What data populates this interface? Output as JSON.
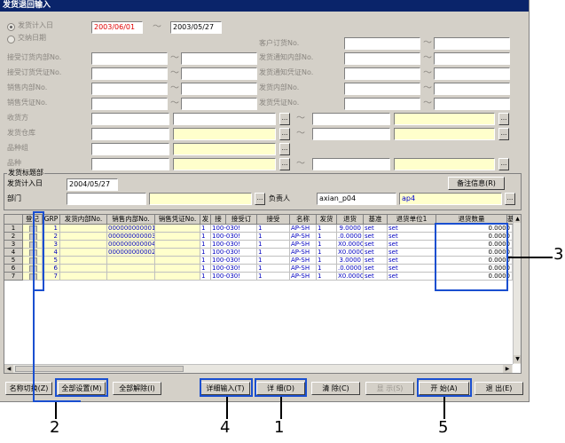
{
  "window": {
    "title": "发货退回输入"
  },
  "criteria": {
    "radio_ship_date": "发货计入日",
    "radio_contract_date": "交纳日期",
    "date_from": "2003/06/01",
    "date_to": "2003/05/27",
    "left_labels": [
      "接受订货内部No.",
      "接受订货凭证No.",
      "销售内部No.",
      "销售凭证No."
    ],
    "right_labels": [
      "客户订货No.",
      "发货通知内部No.",
      "发货通知凭证No.",
      "发货内部No.",
      "发货凭证No."
    ],
    "lower_labels": [
      "收货方",
      "发货仓库",
      "品种组",
      "品种"
    ],
    "tilde": "～",
    "search_btn": "..."
  },
  "shipment": {
    "group_title": "发货标题部",
    "date_label": "发货计入日",
    "date_value": "2004/05/27",
    "dept_label": "部门",
    "person_label": "负责人",
    "person_code": "axian_p04",
    "person_name": "ap4",
    "note_btn": "备注信息(R)"
  },
  "grid": {
    "columns": [
      "登记",
      "GRP",
      "发货内部No.",
      "销售内部No.",
      "销售凭证No.",
      "发",
      "接",
      "接受订",
      "接受",
      "名称",
      "发货",
      "退货",
      "基准",
      "退货单位1",
      "退货数量",
      "基"
    ],
    "rows": [
      {
        "no": "1",
        "grp": "1",
        "sales_no": "000000000001",
        "a": "1",
        "b": "100-030!",
        "c": "1",
        "name": "AP-SH",
        "d": "1",
        "qty": "9.0000",
        "unit": "set",
        "unit1": "set",
        "ret_qty": "0.0000"
      },
      {
        "no": "2",
        "grp": "2",
        "sales_no": "000000000003",
        "a": "1",
        "b": "100-030!",
        "c": "1",
        "name": "AP-SH",
        "d": "1",
        "qty": ".0.0000",
        "unit": "set",
        "unit1": "set",
        "ret_qty": "0.0000"
      },
      {
        "no": "3",
        "grp": "3",
        "sales_no": "000000000004",
        "a": "1",
        "b": "100-030!",
        "c": "1",
        "name": "AP-SH",
        "d": "1",
        "qty": "X0.0000",
        "unit": "set",
        "unit1": "set",
        "ret_qty": "0.0000"
      },
      {
        "no": "4",
        "grp": "4",
        "sales_no": "000000000002",
        "a": "1",
        "b": "100-030!",
        "c": "1",
        "name": "AP-SH",
        "d": "1",
        "qty": "X0.0000",
        "unit": "set",
        "unit1": "set",
        "ret_qty": "0.0000"
      },
      {
        "no": "5",
        "grp": "5",
        "sales_no": "",
        "a": "1",
        "b": "100-030!",
        "c": "1",
        "name": "AP-SH",
        "d": "1",
        "qty": "3.0000",
        "unit": "set",
        "unit1": "set",
        "ret_qty": "0.0000"
      },
      {
        "no": "6",
        "grp": "6",
        "sales_no": "",
        "a": "1",
        "b": "100-030!",
        "c": "1",
        "name": "AP-SH",
        "d": "1",
        "qty": ".0.0000",
        "unit": "set",
        "unit1": "set",
        "ret_qty": "0.0000"
      },
      {
        "no": "7",
        "grp": "7",
        "sales_no": "",
        "a": "1",
        "b": "100-030!",
        "c": "1",
        "name": "AP-SH",
        "d": "1",
        "qty": "X0.0000",
        "unit": "set",
        "unit1": "set",
        "ret_qty": "0.0000"
      }
    ]
  },
  "buttons": {
    "name_switch": "名称切换(Z)",
    "select_all": "全部设置(M)",
    "clear_all": "全部解除(I)",
    "detail_input": "详细输入(T)",
    "detail": "详 细(D)",
    "clear": "清 除(C)",
    "display": "显 示(S)",
    "start": "开 始(A)",
    "exit": "退 出(E)"
  },
  "callouts": [
    "1",
    "2",
    "3",
    "4",
    "5"
  ],
  "colors": {
    "title_bar": "#0a246a",
    "callout_box": "#1a4fd0",
    "highlight": "#ffffcc",
    "date_red": "#e00000"
  }
}
